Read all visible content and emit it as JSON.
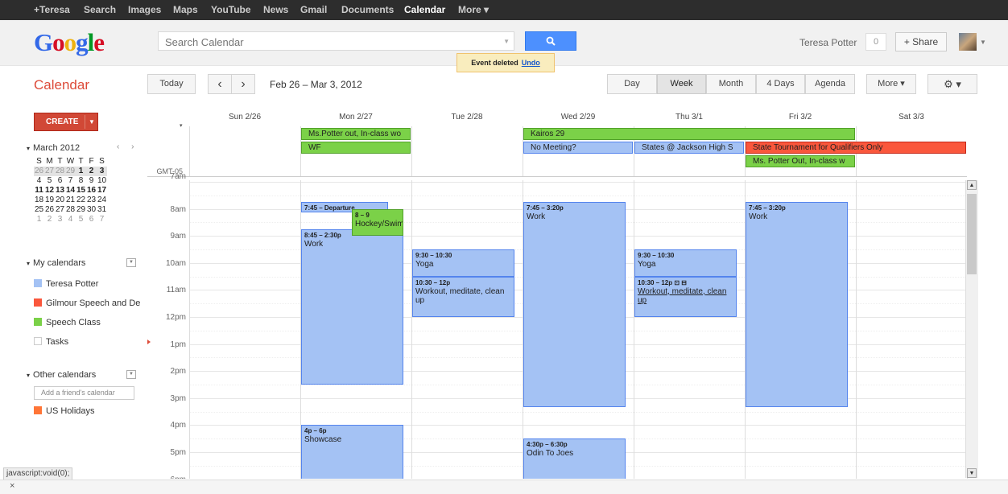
{
  "topbar": {
    "items": [
      "+Teresa",
      "Search",
      "Images",
      "Maps",
      "YouTube",
      "News",
      "Gmail",
      "Documents",
      "Calendar",
      "More ▾"
    ],
    "active": "Calendar"
  },
  "header": {
    "logo": "Google",
    "search_placeholder": "Search Calendar",
    "user_name": "Teresa Potter",
    "notifications": "0",
    "share": "+ Share",
    "toast": {
      "text": "Event deleted",
      "undo": "Undo"
    }
  },
  "toolbar": {
    "title": "Calendar",
    "today": "Today",
    "prev": "‹",
    "next": "›",
    "date_range": "Feb 26 – Mar 3, 2012",
    "views": [
      "Day",
      "Week",
      "Month",
      "4 Days",
      "Agenda"
    ],
    "selected_view": "Week",
    "more": "More ▾",
    "settings": "⚙ ▾"
  },
  "sidebar": {
    "create": "CREATE",
    "mini_cal": {
      "title": "March 2012",
      "nav": "‹ ›",
      "weekdays": [
        "S",
        "M",
        "T",
        "W",
        "T",
        "F",
        "S"
      ],
      "weeks": [
        [
          "26",
          "27",
          "28",
          "29",
          "1",
          "2",
          "3"
        ],
        [
          "4",
          "5",
          "6",
          "7",
          "8",
          "9",
          "10"
        ],
        [
          "11",
          "12",
          "13",
          "14",
          "15",
          "16",
          "17"
        ],
        [
          "18",
          "19",
          "20",
          "21",
          "22",
          "23",
          "24"
        ],
        [
          "25",
          "26",
          "27",
          "28",
          "29",
          "30",
          "31"
        ],
        [
          "1",
          "2",
          "3",
          "4",
          "5",
          "6",
          "7"
        ]
      ]
    },
    "my_calendars_title": "My calendars",
    "my_calendars": [
      {
        "name": "Teresa Potter",
        "color": "#a4c2f4"
      },
      {
        "name": "Gilmour Speech and De",
        "color": "#fa573c"
      },
      {
        "name": "Speech Class",
        "color": "#7bd148"
      },
      {
        "name": "Tasks",
        "color": "#ffffff"
      }
    ],
    "other_calendars_title": "Other calendars",
    "friend_placeholder": "Add a friend's calendar",
    "other_calendars": [
      {
        "name": "US Holidays",
        "color": "#ff7537"
      }
    ]
  },
  "grid": {
    "days": [
      "Sun 2/26",
      "Mon 2/27",
      "Tue 2/28",
      "Wed 2/29",
      "Thu 3/1",
      "Fri 3/2",
      "Sat 3/3"
    ],
    "timezone": "GMT-05",
    "hours": [
      "7am",
      "8am",
      "9am",
      "10am",
      "11am",
      "12pm",
      "1pm",
      "2pm",
      "3pm",
      "4pm",
      "5pm",
      "6pm"
    ],
    "allday": [
      {
        "text": "Ms.Potter out, In-class wo",
        "color": "green"
      },
      {
        "text": "WF",
        "color": "green"
      },
      {
        "text": "Kairos 29",
        "color": "green"
      },
      {
        "text": "No Meeting?",
        "color": "blue"
      },
      {
        "text": "States @ Jackson High S",
        "color": "blue"
      },
      {
        "text": "State Tournament for Qualifiers Only",
        "color": "red"
      },
      {
        "text": "Ms. Potter Out, In-class w",
        "color": "green"
      }
    ],
    "events": [
      {
        "time": "7:45 – Departure",
        "title": "",
        "color": "blue"
      },
      {
        "time": "8 – 9",
        "title": "Hockey/Swimming/Etc",
        "color": "green"
      },
      {
        "time": "8:45 – 2:30p",
        "title": "Work",
        "color": "blue"
      },
      {
        "time": "4p – 6p",
        "title": "Showcase",
        "color": "blue"
      },
      {
        "time": "9:30 – 10:30",
        "title": "Yoga",
        "color": "blue"
      },
      {
        "time": "10:30 – 12p",
        "title": "Workout, meditate, clean up",
        "color": "blue"
      },
      {
        "time": "7:45 – 3:20p",
        "title": "Work",
        "color": "blue"
      },
      {
        "time": "4:30p – 6:30p",
        "title": "Odin To Joes",
        "color": "blue"
      },
      {
        "time": "9:30 – 10:30",
        "title": "Yoga",
        "color": "blue"
      },
      {
        "time": "10:30 – 12p ⊡ ⊟",
        "title": "Workout, meditate, clean up",
        "color": "blue"
      },
      {
        "time": "7:45 – 3:20p",
        "title": "Work",
        "color": "blue"
      }
    ]
  },
  "status_bar": "javascript:void(0);",
  "close": "×"
}
